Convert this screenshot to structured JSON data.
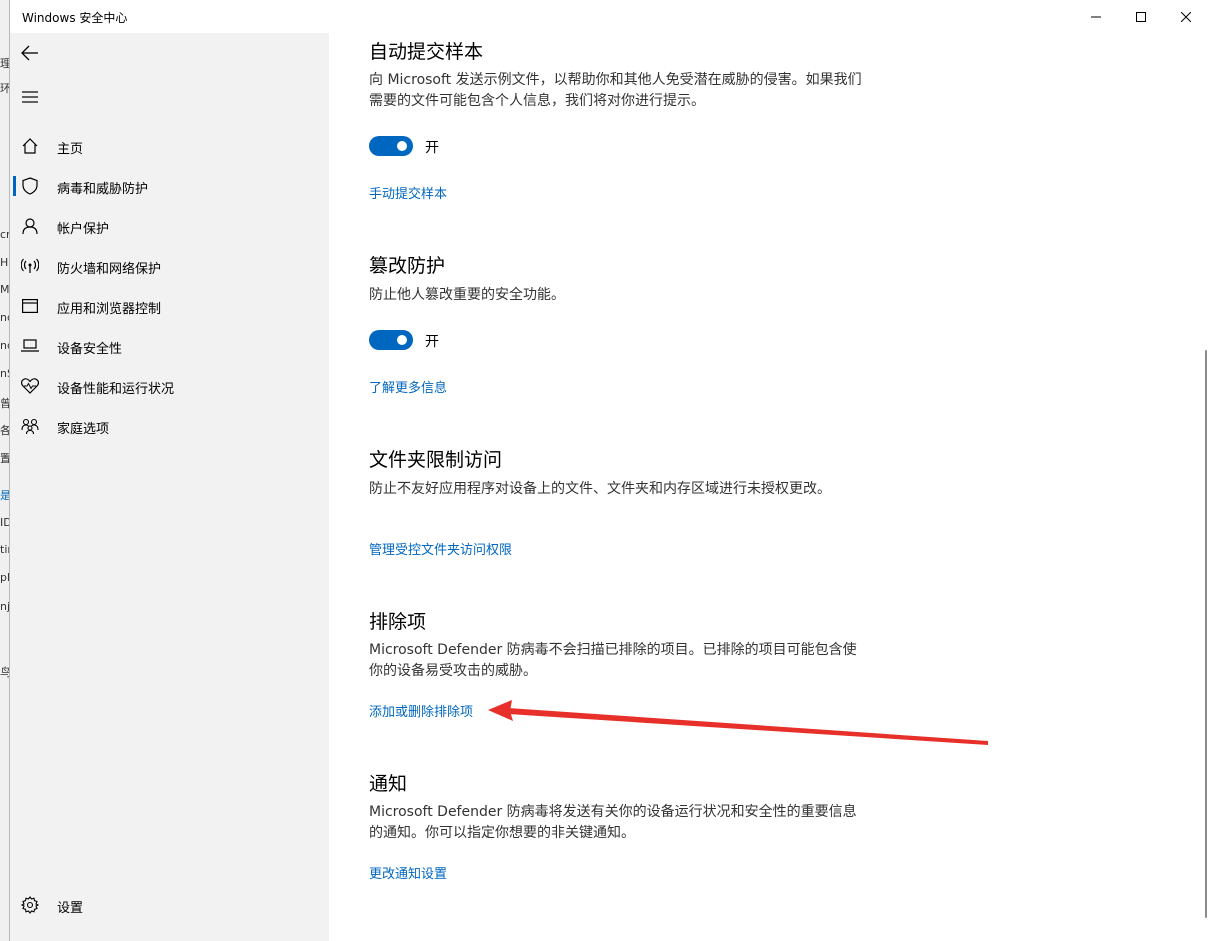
{
  "window": {
    "title": "Windows 安全中心"
  },
  "background_app": {
    "fragments": [
      "理",
      "环",
      "cr",
      "H,",
      "M",
      "nd",
      "nd",
      "nS",
      "曾",
      "各",
      "置",
      "是",
      "ID",
      "tir",
      "pl",
      "nj",
      "鸟"
    ]
  },
  "sidebar": {
    "items": [
      {
        "label": "主页",
        "icon": "home-icon",
        "active": false
      },
      {
        "label": "病毒和威胁防护",
        "icon": "shield-icon",
        "active": true
      },
      {
        "label": "帐户保护",
        "icon": "person-icon",
        "active": false
      },
      {
        "label": "防火墙和网络保护",
        "icon": "wifi-signal-icon",
        "active": false
      },
      {
        "label": "应用和浏览器控制",
        "icon": "browser-window-icon",
        "active": false
      },
      {
        "label": "设备安全性",
        "icon": "laptop-icon",
        "active": false
      },
      {
        "label": "设备性能和运行状况",
        "icon": "heart-pulse-icon",
        "active": false
      },
      {
        "label": "家庭选项",
        "icon": "family-icon",
        "active": false
      }
    ],
    "settings_label": "设置"
  },
  "main": {
    "sections": [
      {
        "title": "自动提交样本",
        "description": "向 Microsoft 发送示例文件，以帮助你和其他人免受潜在威胁的侵害。如果我们需要的文件可能包含个人信息，我们将对你进行提示。",
        "toggle_state": "开",
        "link": "手动提交样本"
      },
      {
        "title": "篡改防护",
        "description": "防止他人篡改重要的安全功能。",
        "toggle_state": "开",
        "link": "了解更多信息"
      },
      {
        "title": "文件夹限制访问",
        "description": "防止不友好应用程序对设备上的文件、文件夹和内存区域进行未授权更改。",
        "link": "管理受控文件夹访问权限"
      },
      {
        "title": "排除项",
        "description": "Microsoft Defender 防病毒不会扫描已排除的项目。已排除的项目可能包含使你的设备易受攻击的威胁。",
        "link": "添加或删除排除项"
      },
      {
        "title": "通知",
        "description": "Microsoft Defender 防病毒将发送有关你的设备运行状况和安全性的重要信息的通知。你可以指定你想要的非关键通知。",
        "link": "更改通知设置"
      }
    ]
  },
  "colors": {
    "accent": "#0067c0",
    "sidebar_bg": "#f2f2f2",
    "annotation_arrow": "#e8302a"
  }
}
